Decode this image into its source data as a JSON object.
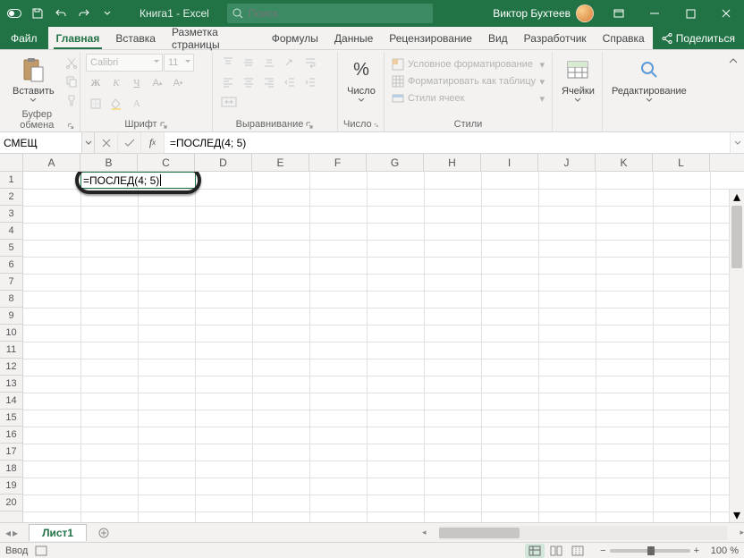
{
  "titlebar": {
    "title": "Книга1  -  Excel",
    "search_placeholder": "Поиск",
    "user_name": "Виктор Бухтеев"
  },
  "tabs": {
    "file": "Файл",
    "items": [
      "Главная",
      "Вставка",
      "Разметка страницы",
      "Формулы",
      "Данные",
      "Рецензирование",
      "Вид",
      "Разработчик",
      "Справка"
    ],
    "active_index": 0,
    "share": "Поделиться"
  },
  "ribbon": {
    "clipboard": {
      "paste": "Вставить",
      "label": "Буфер обмена"
    },
    "font": {
      "font_name": "Calibri",
      "font_size": "11",
      "label": "Шрифт"
    },
    "alignment": {
      "label": "Выравнивание"
    },
    "number": {
      "button": "Число",
      "label": "Число"
    },
    "styles": {
      "cond_fmt": "Условное форматирование",
      "as_table": "Форматировать как таблицу",
      "cell_styles": "Стили ячеек",
      "label": "Стили"
    },
    "cells": {
      "button": "Ячейки"
    },
    "editing": {
      "button": "Редактирование"
    }
  },
  "formula_bar": {
    "name_box": "СМЕЩ",
    "formula": "=ПОСЛЕД(4; 5)"
  },
  "grid": {
    "columns": [
      "A",
      "B",
      "C",
      "D",
      "E",
      "F",
      "G",
      "H",
      "I",
      "J",
      "K",
      "L"
    ],
    "row_count": 20,
    "cell_edit_value": "=ПОСЛЕД(4; 5)"
  },
  "sheets": {
    "active": "Лист1"
  },
  "statusbar": {
    "mode": "Ввод",
    "zoom": "100 %"
  },
  "chart_data": {
    "type": "table",
    "note": "spreadsheet in edit mode; no rendered table values yet",
    "editing_cell": "B1",
    "formula": "=ПОСЛЕД(4; 5)"
  }
}
